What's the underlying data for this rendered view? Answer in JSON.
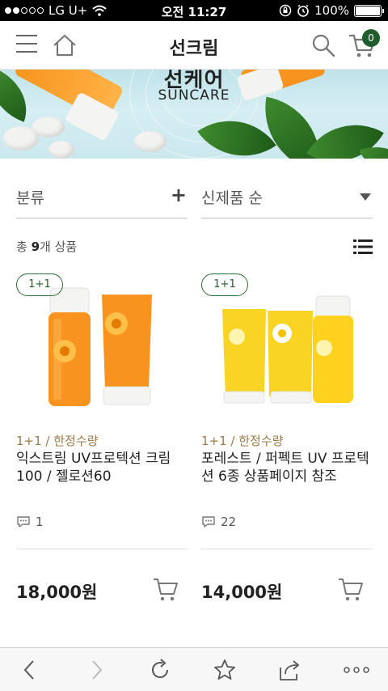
{
  "status_bar": {
    "carrier": "LG U+",
    "time": "오전 11:27",
    "battery": "100%",
    "battery_level": 1.0,
    "signal_bars_filled": 2,
    "signal_bars_total": 5
  },
  "header": {
    "title": "선크림",
    "cart_count": "0"
  },
  "banner": {
    "title_kr": "선케어",
    "title_en": "SUNCARE"
  },
  "filters": {
    "category_label": "분류",
    "category_action": "+",
    "sort_label": "신제품 순"
  },
  "results": {
    "prefix": "총 ",
    "count": "9",
    "suffix": "개 상품"
  },
  "products": [
    {
      "badge": "1+1",
      "tag": "1+1 / 한정수량",
      "name": "익스트림 UV프로텍션 크림 100 / 젤로션60",
      "reviews": "1",
      "price": "18,000원"
    },
    {
      "badge": "1+1",
      "tag": "1+1 / 한정수량",
      "name": "포레스트 / 퍼펙트 UV 프로텍션 6종 상품페이지 참조",
      "reviews": "22",
      "price": "14,000원"
    }
  ],
  "colors": {
    "brand_green": "#1f5e2c",
    "tag_gold": "#9a7b4a",
    "orange": "#f7941d",
    "yellow": "#f9d423"
  },
  "icons": {
    "menu": "hamburger-icon",
    "home": "home-icon",
    "search": "search-icon",
    "cart": "cart-icon",
    "list_view": "list-view-icon",
    "comment": "comment-icon",
    "back": "back-icon",
    "forward": "forward-icon",
    "reload": "reload-icon",
    "bookmark": "star-icon",
    "share": "share-icon",
    "more": "more-icon"
  }
}
